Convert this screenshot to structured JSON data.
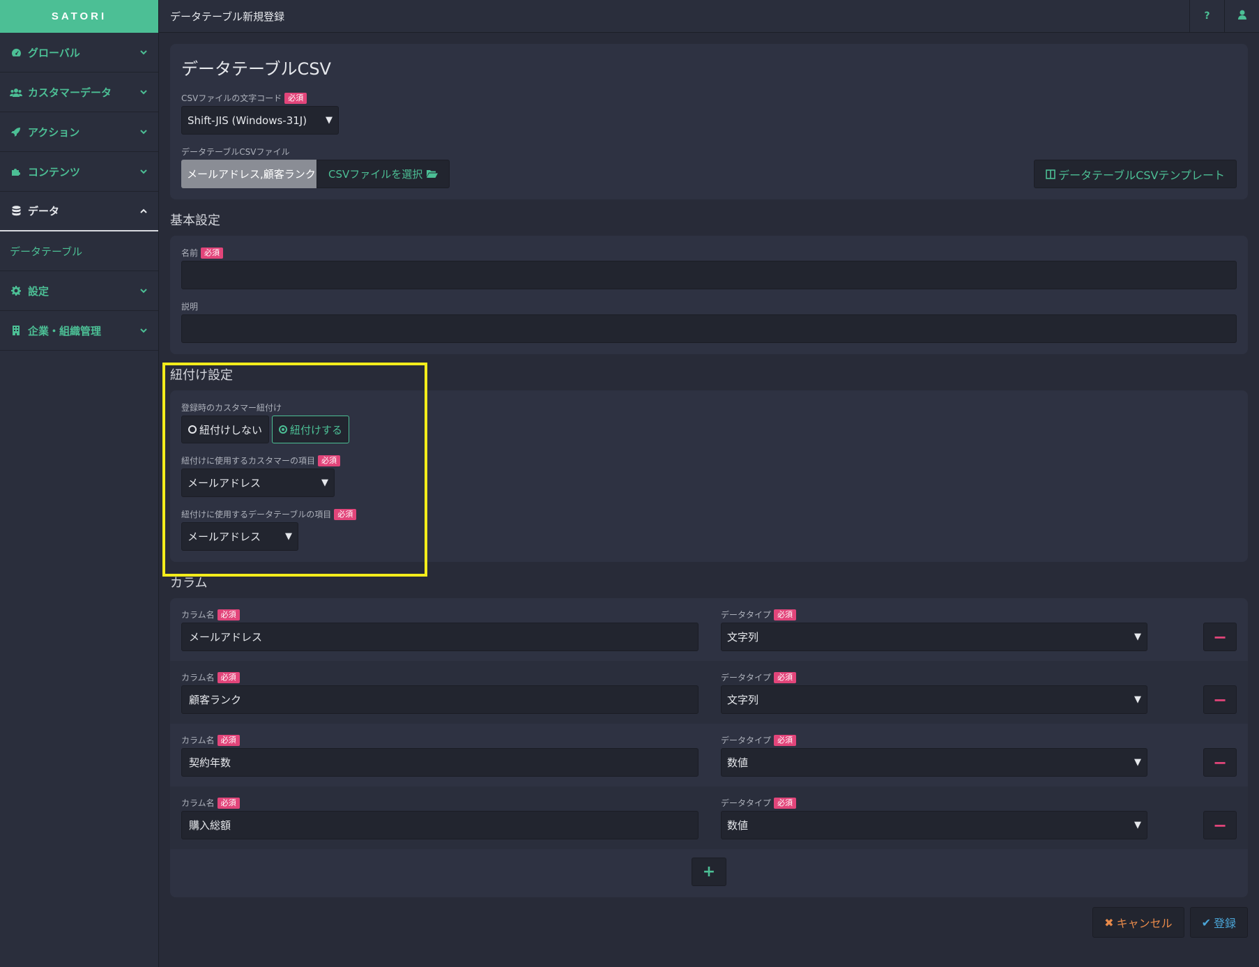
{
  "app": {
    "logo": "SATORI",
    "page_title": "データテーブル新規登録",
    "help_label": "?"
  },
  "sidebar": {
    "items": [
      {
        "label": "グローバル",
        "icon": "dashboard-icon"
      },
      {
        "label": "カスタマーデータ",
        "icon": "users-icon"
      },
      {
        "label": "アクション",
        "icon": "rocket-icon"
      },
      {
        "label": "コンテンツ",
        "icon": "puzzle-icon"
      },
      {
        "label": "データ",
        "icon": "database-icon",
        "active": true
      },
      {
        "label": "設定",
        "icon": "gear-icon"
      },
      {
        "label": "企業・組織管理",
        "icon": "building-icon"
      }
    ],
    "sub_item": "データテーブル"
  },
  "csv": {
    "title": "データテーブルCSV",
    "encoding_label": "CSVファイルの文字コード",
    "encoding_value": "Shift-JIS (Windows-31J)",
    "file_label": "データテーブルCSVファイル",
    "file_name": "メールアドレス,顧客ランク",
    "select_file_label": "CSVファイルを選択",
    "template_label": "データテーブルCSVテンプレート"
  },
  "required_badge": "必須",
  "basic": {
    "title": "基本設定",
    "name_label": "名前",
    "name_value": "",
    "desc_label": "説明",
    "desc_value": ""
  },
  "link": {
    "title": "紐付け設定",
    "mode_label": "登録時のカスタマー紐付け",
    "option_no": "紐付けしない",
    "option_yes": "紐付けする",
    "customer_field_label": "紐付けに使用するカスタマーの項目",
    "customer_field_value": "メールアドレス",
    "table_field_label": "紐付けに使用するデータテーブルの項目",
    "table_field_value": "メールアドレス"
  },
  "columns": {
    "title": "カラム",
    "name_label": "カラム名",
    "type_label": "データタイプ",
    "rows": [
      {
        "name": "メールアドレス",
        "type": "文字列"
      },
      {
        "name": "顧客ランク",
        "type": "文字列"
      },
      {
        "name": "契約年数",
        "type": "数値"
      },
      {
        "name": "購入総額",
        "type": "数値"
      }
    ]
  },
  "footer": {
    "cancel_label": "キャンセル",
    "submit_label": "登録"
  },
  "colors": {
    "accent": "#4cbf95",
    "required": "#e2457a",
    "highlight": "#f3ec1b"
  }
}
